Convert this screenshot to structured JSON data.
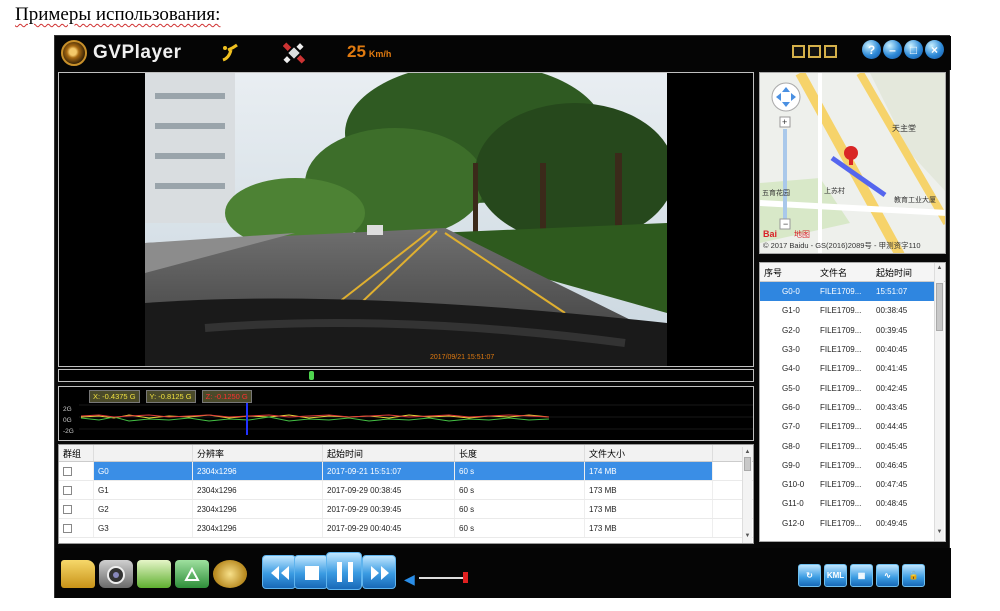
{
  "document": {
    "heading": "Примеры использования:"
  },
  "app": {
    "title": "GVPlayer",
    "speed_value": "25",
    "speed_unit": "Km/h"
  },
  "video": {
    "overlay_text": "2017/09/21 15:51:07"
  },
  "gsensor": {
    "x_label": "X: -0.4375 G",
    "y_label": "Y: -0.8125 G",
    "z_label": "Z: -0.1250 G",
    "ticks": [
      "2G",
      "0G",
      "-2G"
    ]
  },
  "file_table": {
    "headers": [
      "群组",
      "",
      "分辨率",
      "起始时间",
      "长度",
      "文件大小"
    ],
    "rows": [
      {
        "group": "G0",
        "resolution": "2304x1296",
        "start": "2017-09-21 15:51:07",
        "length": "60 s",
        "size": "174 MB",
        "selected": true
      },
      {
        "group": "G1",
        "resolution": "2304x1296",
        "start": "2017-09-29 00:38:45",
        "length": "60 s",
        "size": "173 MB",
        "selected": false
      },
      {
        "group": "G2",
        "resolution": "2304x1296",
        "start": "2017-09-29 00:39:45",
        "length": "60 s",
        "size": "173 MB",
        "selected": false
      },
      {
        "group": "G3",
        "resolution": "2304x1296",
        "start": "2017-09-29 00:40:45",
        "length": "60 s",
        "size": "173 MB",
        "selected": false
      }
    ]
  },
  "map": {
    "credit": "© 2017 Baidu - GS(2016)2089号 - 甲测资字110",
    "logo_text": "Bai",
    "logo_suffix": "地图",
    "labels": {
      "poi1": "天主堂",
      "poi2": "五育花园",
      "poi3": "上苏村",
      "poi4": "教育工业大厦"
    }
  },
  "segment_list": {
    "headers": [
      "序号",
      "文件名",
      "起始时间"
    ],
    "rows": [
      {
        "id": "G0-0",
        "file": "FILE1709...",
        "time": "15:51:07",
        "selected": true
      },
      {
        "id": "G1-0",
        "file": "FILE1709...",
        "time": "00:38:45",
        "selected": false
      },
      {
        "id": "G2-0",
        "file": "FILE1709...",
        "time": "00:39:45",
        "selected": false
      },
      {
        "id": "G3-0",
        "file": "FILE1709...",
        "time": "00:40:45",
        "selected": false
      },
      {
        "id": "G4-0",
        "file": "FILE1709...",
        "time": "00:41:45",
        "selected": false
      },
      {
        "id": "G5-0",
        "file": "FILE1709...",
        "time": "00:42:45",
        "selected": false
      },
      {
        "id": "G6-0",
        "file": "FILE1709...",
        "time": "00:43:45",
        "selected": false
      },
      {
        "id": "G7-0",
        "file": "FILE1709...",
        "time": "00:44:45",
        "selected": false
      },
      {
        "id": "G8-0",
        "file": "FILE1709...",
        "time": "00:45:45",
        "selected": false
      },
      {
        "id": "G9-0",
        "file": "FILE1709...",
        "time": "00:46:45",
        "selected": false
      },
      {
        "id": "G10-0",
        "file": "FILE1709...",
        "time": "00:47:45",
        "selected": false
      },
      {
        "id": "G11-0",
        "file": "FILE1709...",
        "time": "00:48:45",
        "selected": false
      },
      {
        "id": "G12-0",
        "file": "FILE1709...",
        "time": "00:49:45",
        "selected": false
      }
    ]
  },
  "toolbar": {
    "kml_label": "KML",
    "volume_level": 0.95
  },
  "colors": {
    "selection_blue": "#2f86e0",
    "speed_orange": "#e07a10",
    "control_blue": "#3a9be2"
  }
}
